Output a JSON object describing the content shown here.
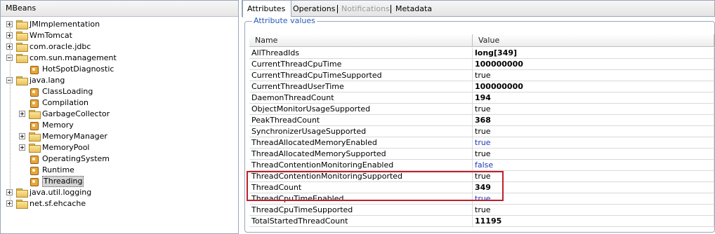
{
  "left_panel": {
    "title": "MBeans",
    "tree": [
      {
        "label": "JMImplementation",
        "kind": "folder",
        "expander": "plus",
        "level": 0
      },
      {
        "label": "WmTomcat",
        "kind": "folder",
        "expander": "plus",
        "level": 0
      },
      {
        "label": "com.oracle.jdbc",
        "kind": "folder",
        "expander": "plus",
        "level": 0
      },
      {
        "label": "com.sun.management",
        "kind": "folder",
        "expander": "minus",
        "level": 0
      },
      {
        "label": "HotSpotDiagnostic",
        "kind": "bean",
        "expander": "none",
        "level": 1
      },
      {
        "label": "java.lang",
        "kind": "folder",
        "expander": "minus",
        "level": 0
      },
      {
        "label": "ClassLoading",
        "kind": "bean",
        "expander": "none",
        "level": 1
      },
      {
        "label": "Compilation",
        "kind": "bean",
        "expander": "none",
        "level": 1
      },
      {
        "label": "GarbageCollector",
        "kind": "folder",
        "expander": "plus",
        "level": 1
      },
      {
        "label": "Memory",
        "kind": "bean",
        "expander": "none",
        "level": 1
      },
      {
        "label": "MemoryManager",
        "kind": "folder",
        "expander": "plus",
        "level": 1
      },
      {
        "label": "MemoryPool",
        "kind": "folder",
        "expander": "plus",
        "level": 1
      },
      {
        "label": "OperatingSystem",
        "kind": "bean",
        "expander": "none",
        "level": 1
      },
      {
        "label": "Runtime",
        "kind": "bean",
        "expander": "none",
        "level": 1
      },
      {
        "label": "Threading",
        "kind": "bean",
        "expander": "none",
        "level": 1,
        "selected": true
      },
      {
        "label": "java.util.logging",
        "kind": "folder",
        "expander": "plus",
        "level": 0
      },
      {
        "label": "net.sf.ehcache",
        "kind": "folder",
        "expander": "plus",
        "level": 0
      }
    ]
  },
  "tabs": [
    {
      "label": "Attributes",
      "state": "active"
    },
    {
      "label": "Operations",
      "state": "normal"
    },
    {
      "label": "Notifications",
      "state": "disabled"
    },
    {
      "label": "Metadata",
      "state": "normal"
    }
  ],
  "attributes": {
    "group_title": "Attribute values",
    "columns": {
      "name": "Name",
      "value": "Value"
    },
    "rows": [
      {
        "name": "AllThreadIds",
        "value": "long[349]",
        "style": "bold"
      },
      {
        "name": "CurrentThreadCpuTime",
        "value": "100000000",
        "style": "bold"
      },
      {
        "name": "CurrentThreadCpuTimeSupported",
        "value": "true",
        "style": "plain"
      },
      {
        "name": "CurrentThreadUserTime",
        "value": "100000000",
        "style": "bold"
      },
      {
        "name": "DaemonThreadCount",
        "value": "194",
        "style": "bold"
      },
      {
        "name": "ObjectMonitorUsageSupported",
        "value": "true",
        "style": "plain"
      },
      {
        "name": "PeakThreadCount",
        "value": "368",
        "style": "bold"
      },
      {
        "name": "SynchronizerUsageSupported",
        "value": "true",
        "style": "plain"
      },
      {
        "name": "ThreadAllocatedMemoryEnabled",
        "value": "true",
        "style": "blue"
      },
      {
        "name": "ThreadAllocatedMemorySupported",
        "value": "true",
        "style": "plain"
      },
      {
        "name": "ThreadContentionMonitoringEnabled",
        "value": "false",
        "style": "blue"
      },
      {
        "name": "ThreadContentionMonitoringSupported",
        "value": "true",
        "style": "plain"
      },
      {
        "name": "ThreadCount",
        "value": "349",
        "style": "bold"
      },
      {
        "name": "ThreadCpuTimeEnabled",
        "value": "true",
        "style": "blue"
      },
      {
        "name": "ThreadCpuTimeSupported",
        "value": "true",
        "style": "plain"
      },
      {
        "name": "TotalStartedThreadCount",
        "value": "11195",
        "style": "bold"
      }
    ]
  },
  "colors": {
    "highlight_box": "#c0202a",
    "group_title": "#2a5bb5",
    "editable_value": "#1a3bb8"
  }
}
